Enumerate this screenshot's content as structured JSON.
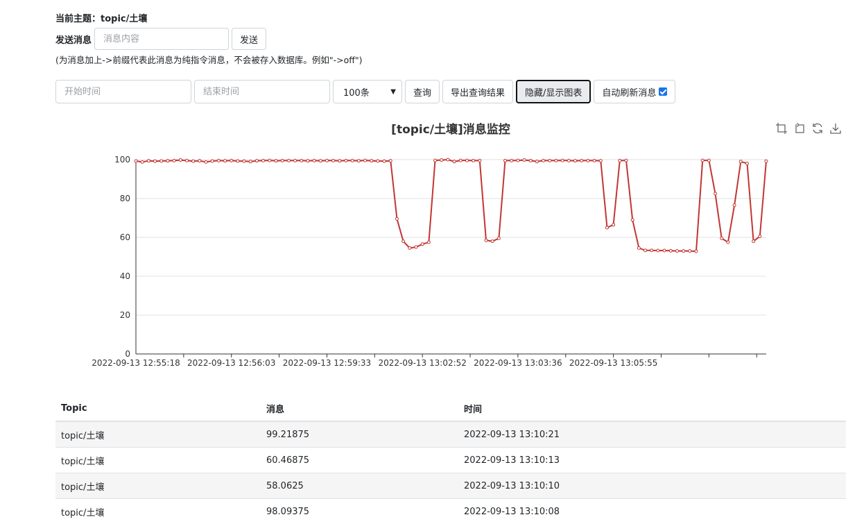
{
  "topic": {
    "text": "当前主题：topic/土壤"
  },
  "send": {
    "label": "发送消息",
    "placeholder": "消息内容",
    "button": "发送"
  },
  "hint": "(为消息加上->前缀代表此消息为纯指令消息，不会被存入数据库。例如\"->off\")",
  "query": {
    "start_placeholder": "开始时间",
    "end_placeholder": "结束时间",
    "count_selected": "100条",
    "query_button": "查询",
    "export_button": "导出查询结果",
    "toggle_chart_button": "隐藏/显示图表",
    "auto_refresh_label": "自动刷新消息",
    "auto_refresh_checked": true
  },
  "toolbox_icons": [
    "zoom-icon",
    "zoom-reset-icon",
    "restore-icon",
    "save-image-icon"
  ],
  "chart_data": {
    "type": "line",
    "title": "[topic/土壤]消息监控",
    "line_color": "#c23531",
    "ylim": [
      0,
      100
    ],
    "yticks": [
      0,
      20,
      40,
      60,
      80,
      100
    ],
    "xtick_labels": [
      "2022-09-13 12:55:18",
      "2022-09-13 12:56:03",
      "2022-09-13 12:59:33",
      "2022-09-13 13:02:52",
      "2022-09-13 13:03:36",
      "2022-09-13 13:05:55"
    ],
    "values": [
      99.3,
      98.8,
      99.4,
      99.2,
      99.3,
      99.4,
      99.5,
      99.8,
      99.5,
      99.2,
      99.4,
      98.8,
      99.3,
      99.5,
      99.4,
      99.5,
      99.3,
      99.2,
      99,
      99.4,
      99.5,
      99.6,
      99.4,
      99.5,
      99.5,
      99.5,
      99.5,
      99.4,
      99.5,
      99.4,
      99.5,
      99.5,
      99.4,
      99.5,
      99.5,
      99.4,
      99.6,
      99.4,
      99.3,
      99.2,
      99.4,
      69.5,
      58,
      54.5,
      55,
      56.5,
      57.5,
      99.6,
      99.8,
      100,
      99,
      99.6,
      99.6,
      99.5,
      99.5,
      58.5,
      58,
      59.5,
      99.5,
      99.5,
      99.6,
      99.8,
      99.5,
      99,
      99.5,
      99.5,
      99.5,
      99.6,
      99.5,
      99.4,
      99.5,
      99.5,
      99.5,
      99.4,
      65,
      66.5,
      99.5,
      99.6,
      69,
      54.5,
      53.3,
      53.3,
      53.2,
      53.2,
      53.1,
      53,
      53,
      53,
      52.8,
      99.6,
      99.6,
      82.5,
      59.5,
      57.5,
      76.5,
      99,
      98,
      58,
      60.5,
      99.21875
    ]
  },
  "table": {
    "headers": [
      "Topic",
      "消息",
      "时间"
    ],
    "rows": [
      [
        "topic/土壤",
        "99.21875",
        "2022-09-13 13:10:21"
      ],
      [
        "topic/土壤",
        "60.46875",
        "2022-09-13 13:10:13"
      ],
      [
        "topic/土壤",
        "58.0625",
        "2022-09-13 13:10:10"
      ],
      [
        "topic/土壤",
        "98.09375",
        "2022-09-13 13:10:08"
      ]
    ]
  }
}
